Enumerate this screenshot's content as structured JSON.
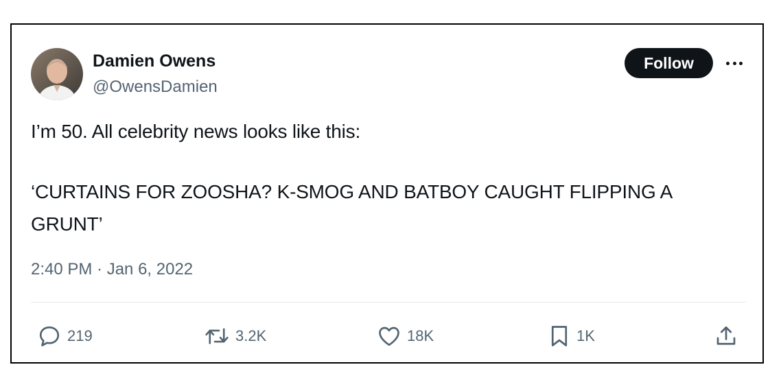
{
  "author": {
    "name": "Damien Owens",
    "handle": "@OwensDamien",
    "avatar_icon": "profile-photo-man"
  },
  "follow_label": "Follow",
  "more_icon": "more-horizontal-icon",
  "tweet": {
    "line1": "I’m 50. All celebrity news looks like this:",
    "line2": "‘CURTAINS FOR ZOOSHA? K-SMOG AND BATBOY CAUGHT FLIPPING A",
    "line3": "GRUNT’"
  },
  "timestamp": "2:40 PM · Jan 6, 2022",
  "actions": {
    "replies": "219",
    "retweets": "3.2K",
    "likes": "18K",
    "bookmarks": "1K"
  },
  "colors": {
    "text": "#0f1419",
    "secondary": "#536471",
    "divider": "#e6ecf0",
    "button_bg": "#0f1419"
  }
}
